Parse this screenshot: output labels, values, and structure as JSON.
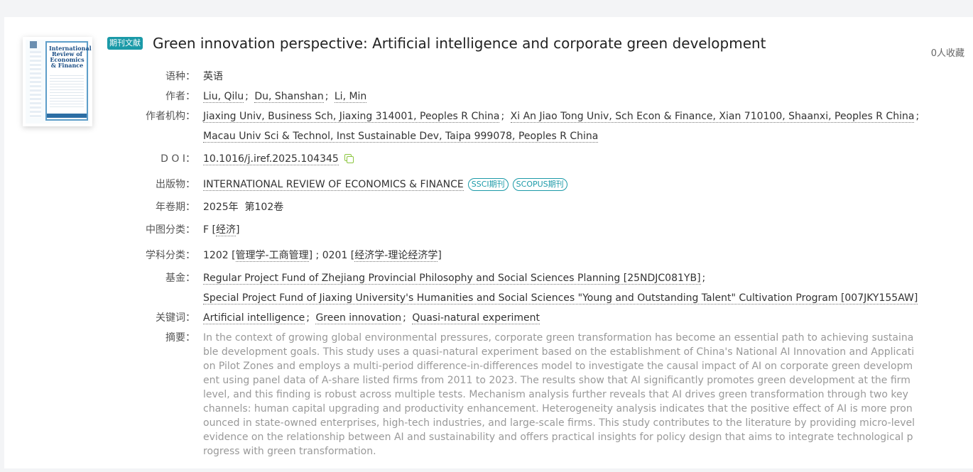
{
  "record": {
    "type_badge": "期刊文献",
    "title": "Green innovation perspective: Artificial intelligence and corporate green development",
    "favorites": "0人收藏",
    "cover": {
      "journal_title": "International Review of Economics & Finance",
      "colors": {
        "frame": "#5e9ec9",
        "title": "#1c4f86"
      }
    }
  },
  "fields": {
    "language": {
      "label": "语种：",
      "value": "英语"
    },
    "authors": {
      "label": "作者：",
      "items": [
        "Liu, Qilu",
        "Du, Shanshan",
        "Li, Min"
      ],
      "separator": ";"
    },
    "institutions": {
      "label": "作者机构：",
      "items": [
        "Jiaxing Univ, Business Sch, Jiaxing 314001, Peoples R China",
        "Xi An Jiao Tong Univ, Sch Econ & Finance, Xian 710100, Shaanxi, Peoples R China",
        "Macau Univ Sci & Technol, Inst Sustainable Dev, Taipa 999078, Peoples R China"
      ],
      "separator": ";"
    },
    "doi": {
      "label": "D O I：",
      "value": "10.1016/j.iref.2025.104345",
      "copy_icon": "copy-icon"
    },
    "publication": {
      "label": "出版物：",
      "value": "INTERNATIONAL REVIEW OF ECONOMICS & FINANCE",
      "tags": [
        "SSCI期刊",
        "SCOPUS期刊"
      ]
    },
    "year_volume": {
      "label": "年卷期：",
      "value": "2025年  第102卷"
    },
    "clc": {
      "label": "中图分类：",
      "code": "F",
      "link": "经济"
    },
    "subject": {
      "label": "学科分类：",
      "code1": "1202",
      "link1": "管理学-工商管理",
      "code2": "0201",
      "link2": "经济学-理论经济学"
    },
    "funding": {
      "label": "基金：",
      "items": [
        "Regular Project Fund of Zhejiang Provincial Philosophy and Social Sciences Planning [25NDJC081YB]",
        "Special Project Fund of Jiaxing University's Humanities and Social Sciences \"Young and Outstanding Talent\" Cultivation Program [007JKY155AW]"
      ],
      "separator": ";"
    },
    "keywords": {
      "label": "关键词：",
      "items": [
        "Artificial intelligence",
        "Green innovation",
        "Quasi-natural experiment"
      ],
      "separator": ";"
    },
    "abstract": {
      "label": "摘要：",
      "value": "In the context of growing global environmental pressures, corporate green transformation has become an essential path to achieving sustainable development goals. This study uses a quasi-natural experiment based on the establishment of China's National AI Innovation and Application Pilot Zones and employs a multi-period difference-in-differences model to investigate the causal impact of AI on corporate green development using panel data of A-share listed firms from 2011 to 2023. The results show that AI significantly promotes green development at the firm level, and this finding is robust across multiple tests. Mechanism analysis further reveals that AI drives green transformation through two key channels: human capital upgrading and productivity enhancement. Heterogeneity analysis indicates that the positive effect of AI is more pronounced in state-owned enterprises, high-tech industries, and large-scale firms. This study contributes to the literature by providing micro-level evidence on the relationship between AI and sustainability and offers practical insights for policy design that aims to integrate technological progress with green transformation."
    }
  },
  "colors": {
    "accent": "#1b9aa8",
    "copy_icon": "#8cc63f",
    "abstract_text": "#999999"
  }
}
